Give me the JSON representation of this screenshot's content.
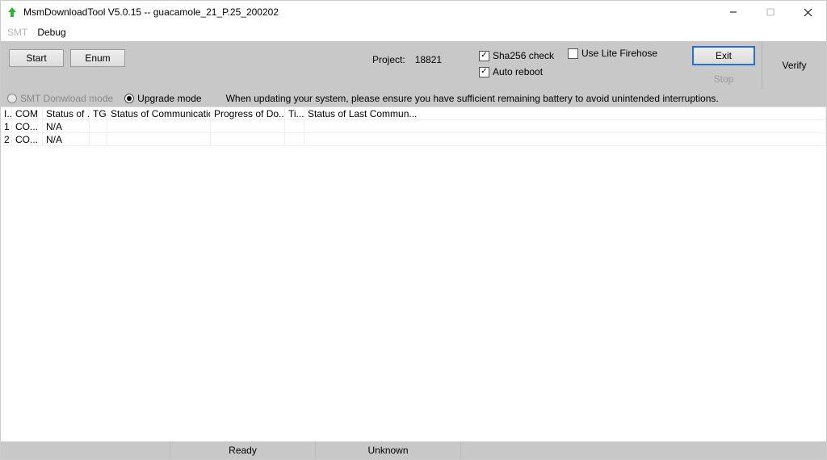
{
  "window": {
    "title": "MsmDownloadTool V5.0.15 -- guacamole_21_P.25_200202"
  },
  "menu": {
    "smt": "SMT",
    "debug": "Debug"
  },
  "toolbar": {
    "start_label": "Start",
    "enum_label": "Enum",
    "project_label": "Project:",
    "project_value": "18821",
    "sha256_label": "Sha256 check",
    "autoreboot_label": "Auto reboot",
    "litefirehose_label": "Use Lite Firehose",
    "exit_label": "Exit",
    "stop_label": "Stop",
    "verify_label": "Verify",
    "sha256_checked": true,
    "autoreboot_checked": true,
    "litefirehose_checked": false
  },
  "modes": {
    "smt_label": "SMT Donwload mode",
    "upgrade_label": "Upgrade mode",
    "tip": "When updating your system, please ensure you have sufficient remaining battery to avoid unintended interruptions."
  },
  "grid": {
    "headers": {
      "id": "I...",
      "com": "COM",
      "status_dl": "Status of ...",
      "tg": "TG",
      "status_comm": "Status of Communication",
      "progress": "Progress of Do...",
      "time": "Ti...",
      "last": "Status of Last Commun..."
    },
    "rows": [
      {
        "id": "1",
        "com": "CO...",
        "status_dl": "N/A",
        "tg": "",
        "status_comm": "",
        "progress": "",
        "time": "",
        "last": ""
      },
      {
        "id": "2",
        "com": "CO...",
        "status_dl": "N/A",
        "tg": "",
        "status_comm": "",
        "progress": "",
        "time": "",
        "last": ""
      }
    ]
  },
  "status": {
    "ready": "Ready",
    "unknown": "Unknown"
  }
}
